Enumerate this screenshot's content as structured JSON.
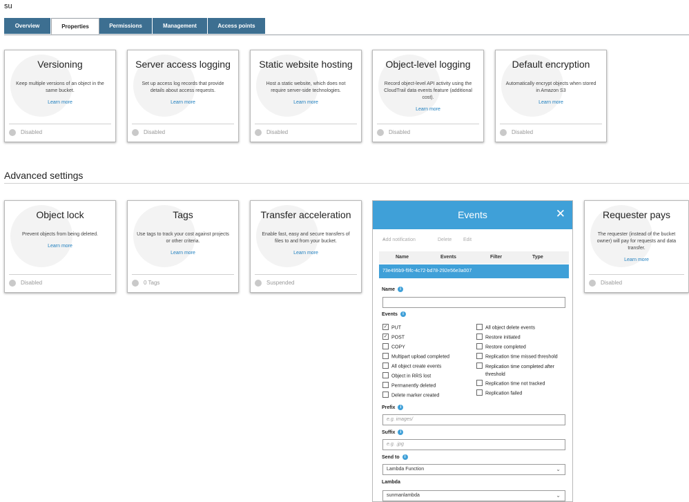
{
  "header": {
    "bucket_name": "su"
  },
  "tabs": [
    {
      "label": "Overview"
    },
    {
      "label": "Properties"
    },
    {
      "label": "Permissions"
    },
    {
      "label": "Management"
    },
    {
      "label": "Access points"
    }
  ],
  "property_cards": [
    {
      "title": "Versioning",
      "desc": "Keep multiple versions of an object in the same bucket.",
      "learn": "Learn more",
      "status": "Disabled"
    },
    {
      "title": "Server access logging",
      "desc": "Set up access log records that provide details about access requests.",
      "learn": "Learn more",
      "status": "Disabled"
    },
    {
      "title": "Static website hosting",
      "desc": "Host a static website, which does not require server-side technologies.",
      "learn": "Learn more",
      "status": "Disabled"
    },
    {
      "title": "Object-level logging",
      "desc": "Record object-level API activity using the CloudTrail data events feature (additional cost).",
      "learn": "Learn more",
      "status": "Disabled"
    },
    {
      "title": "Default encryption",
      "desc": "Automatically encrypt objects when stored in Amazon S3",
      "learn": "Learn more",
      "status": "Disabled"
    }
  ],
  "advanced": {
    "section_title": "Advanced settings",
    "cards": [
      {
        "title": "Object lock",
        "desc": "Prevent objects from being deleted.",
        "learn": "Learn more",
        "status": "Disabled"
      },
      {
        "title": "Tags",
        "desc": "Use tags to track your cost against projects or other criteria.",
        "learn": "Learn more",
        "status": "0 Tags"
      },
      {
        "title": "Transfer acceleration",
        "desc": "Enable fast, easy and secure transfers of files to and from your bucket.",
        "learn": "Learn more",
        "status": "Suspended"
      },
      {
        "title": "Requester pays",
        "desc": "The requester (instead of the bucket owner) will pay for requests and data transfer.",
        "learn": "Learn more",
        "status": "Disabled"
      }
    ]
  },
  "events_panel": {
    "title": "Events",
    "toolbar": {
      "add": "Add notification",
      "delete": "Delete",
      "edit": "Edit"
    },
    "columns": [
      "Name",
      "Events",
      "Filter",
      "Type"
    ],
    "selected_row": "73e495b9-f9fc-4c72-bd78-292e56e3a007",
    "name_label": "Name",
    "name_value": "",
    "events_label": "Events",
    "events_left": [
      {
        "label": "PUT",
        "checked": true
      },
      {
        "label": "POST",
        "checked": true
      },
      {
        "label": "COPY",
        "checked": false
      },
      {
        "label": "Multipart upload completed",
        "checked": false
      },
      {
        "label": "All object create events",
        "checked": false
      },
      {
        "label": "Object in RRS lost",
        "checked": false
      },
      {
        "label": "Permanently deleted",
        "checked": false
      },
      {
        "label": "Delete marker created",
        "checked": false
      }
    ],
    "events_right": [
      {
        "label": "All object delete events",
        "checked": false
      },
      {
        "label": "Restore initiated",
        "checked": false
      },
      {
        "label": "Restore completed",
        "checked": false
      },
      {
        "label": "Replication time missed threshold",
        "checked": false
      },
      {
        "label": "Replication time completed after threshold",
        "checked": false
      },
      {
        "label": "Replication time not tracked",
        "checked": false
      },
      {
        "label": "Replication failed",
        "checked": false
      }
    ],
    "prefix_label": "Prefix",
    "prefix_placeholder": "e.g. images/",
    "suffix_label": "Suffix",
    "suffix_placeholder": "e.g. .jpg",
    "send_to_label": "Send to",
    "send_to_value": "Lambda Function",
    "lambda_label": "Lambda",
    "lambda_value": "sunmanlambda"
  },
  "colors": {
    "tab_bg": "#3d6f91",
    "accent": "#3fa0d8",
    "link": "#1f7fbf"
  }
}
